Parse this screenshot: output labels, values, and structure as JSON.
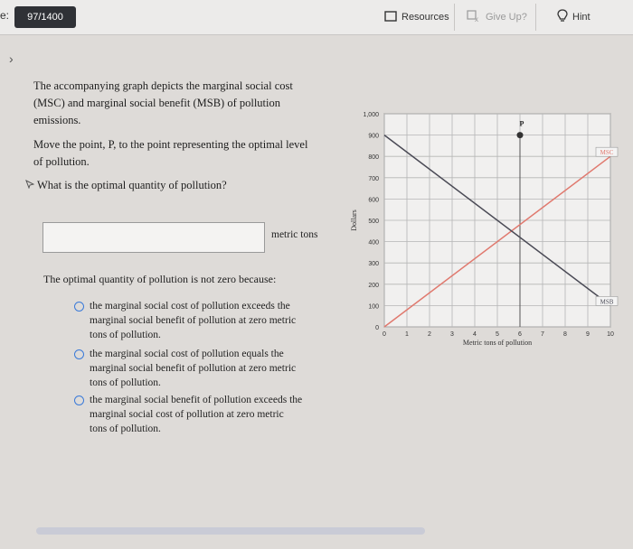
{
  "topbar": {
    "edge_text": "e:",
    "progress": "97/1400",
    "resources_label": "Resources",
    "giveup_label": "Give Up?",
    "hint_label": "Hint"
  },
  "question": {
    "intro_lines": [
      "The accompanying graph depicts the marginal social cost",
      "(MSC) and marginal social benefit (MSB) of pollution",
      "emissions."
    ],
    "instruction_lines": [
      "Move the point, P, to the point representing the optimal level",
      "of pollution."
    ],
    "prompt": "What is the optimal quantity of pollution?",
    "answer_value": "",
    "unit": "metric tons",
    "reason_prompt": "The optimal quantity of pollution is not zero because:",
    "options": [
      {
        "lines": [
          "the marginal social cost of pollution exceeds the",
          "marginal social benefit of pollution at zero metric",
          "tons of pollution."
        ]
      },
      {
        "lines": [
          "the marginal social cost of pollution equals the",
          "marginal social benefit of pollution at zero metric",
          "tons of pollution."
        ]
      },
      {
        "lines": [
          "the marginal social benefit of pollution exceeds the",
          "marginal social cost of pollution at zero metric",
          "tons of pollution."
        ]
      }
    ]
  },
  "chart_data": {
    "type": "line",
    "xlabel": "Metric tons of pollution",
    "ylabel": "Dollars",
    "xlim": [
      0,
      10
    ],
    "ylim": [
      0,
      1000
    ],
    "x_ticks": [
      0,
      1,
      2,
      3,
      4,
      5,
      6,
      7,
      8,
      9,
      10
    ],
    "y_ticks": [
      0,
      100,
      200,
      300,
      400,
      500,
      600,
      700,
      800,
      900,
      1000
    ],
    "y_tick_labels": [
      "0",
      "100",
      "200",
      "300",
      "400",
      "500",
      "600",
      "700",
      "800",
      "900",
      "1,000"
    ],
    "grid": true,
    "series": [
      {
        "name": "MSC",
        "x": [
          0,
          10
        ],
        "y": [
          0,
          800
        ],
        "color": "#e0796e"
      },
      {
        "name": "MSB",
        "x": [
          0,
          10
        ],
        "y": [
          900,
          100
        ],
        "color": "#4a4a55"
      }
    ],
    "point": {
      "label": "P",
      "x": 6,
      "y": 900
    },
    "guide_line_x": 6
  }
}
